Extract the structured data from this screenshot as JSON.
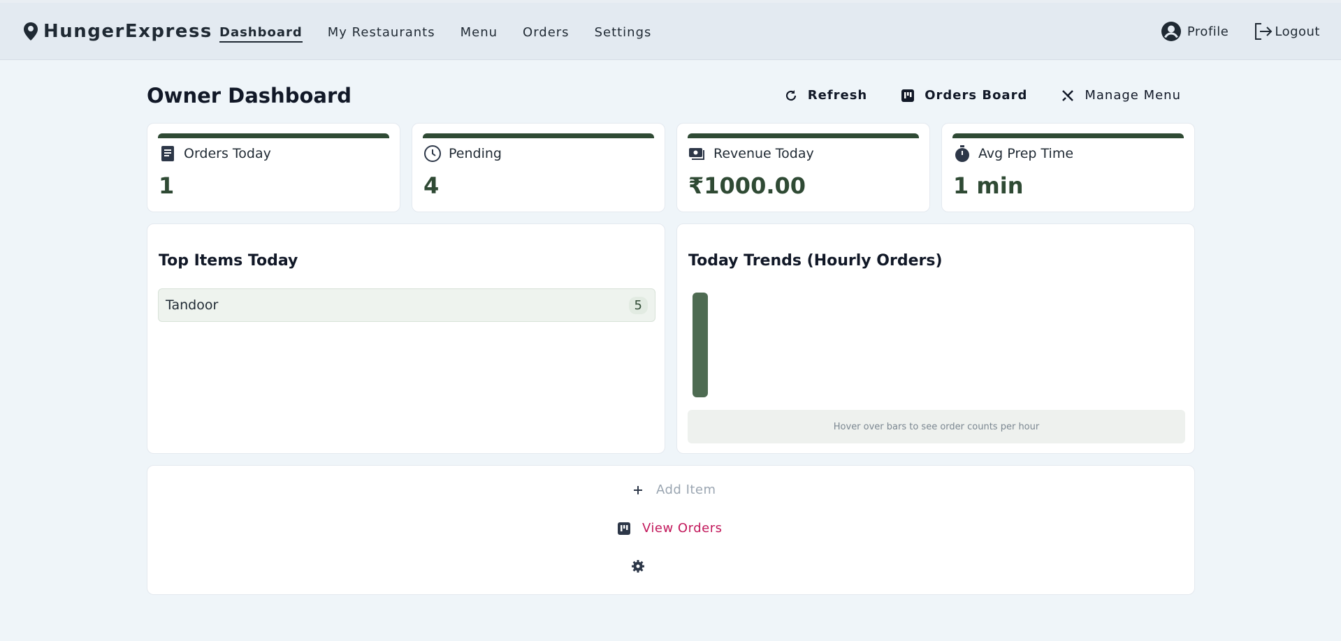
{
  "brand": {
    "name": "HungerExpress"
  },
  "nav": {
    "links": [
      {
        "label": "Dashboard",
        "active": true
      },
      {
        "label": "My Restaurants",
        "active": false
      },
      {
        "label": "Menu",
        "active": false
      },
      {
        "label": "Orders",
        "active": false
      },
      {
        "label": "Settings",
        "active": false
      }
    ],
    "profile_label": "Profile",
    "logout_label": "Logout"
  },
  "page": {
    "title": "Owner Dashboard",
    "actions": {
      "refresh_label": "Refresh",
      "orders_board_label": "Orders Board",
      "manage_menu_label": "Manage Menu"
    }
  },
  "stats": [
    {
      "label": "Orders Today",
      "value": "1",
      "icon": "receipt-icon"
    },
    {
      "label": "Pending",
      "value": "4",
      "icon": "clock-icon"
    },
    {
      "label": "Revenue Today",
      "value": "₹1000.00",
      "icon": "cash-icon"
    },
    {
      "label": "Avg Prep Time",
      "value": "1 min",
      "icon": "stopwatch-icon"
    }
  ],
  "top_items": {
    "title": "Top Items Today",
    "items": [
      {
        "name": "Tandoor",
        "count": "5"
      }
    ]
  },
  "trends": {
    "title": "Today Trends (Hourly Orders)",
    "hint": "Hover over bars to see order counts per hour"
  },
  "chart_data": {
    "type": "bar",
    "title": "Today Trends (Hourly Orders)",
    "categories": [
      ""
    ],
    "values": [
      1
    ],
    "ylim": [
      0,
      1
    ],
    "color": "#4e6b52",
    "grid": false
  },
  "quick_actions": {
    "add_item_label": "Add Item",
    "view_orders_label": "View Orders"
  },
  "colors": {
    "accent": "#2f4a34",
    "link": "#c2185b",
    "muted": "#9aa5b1"
  }
}
